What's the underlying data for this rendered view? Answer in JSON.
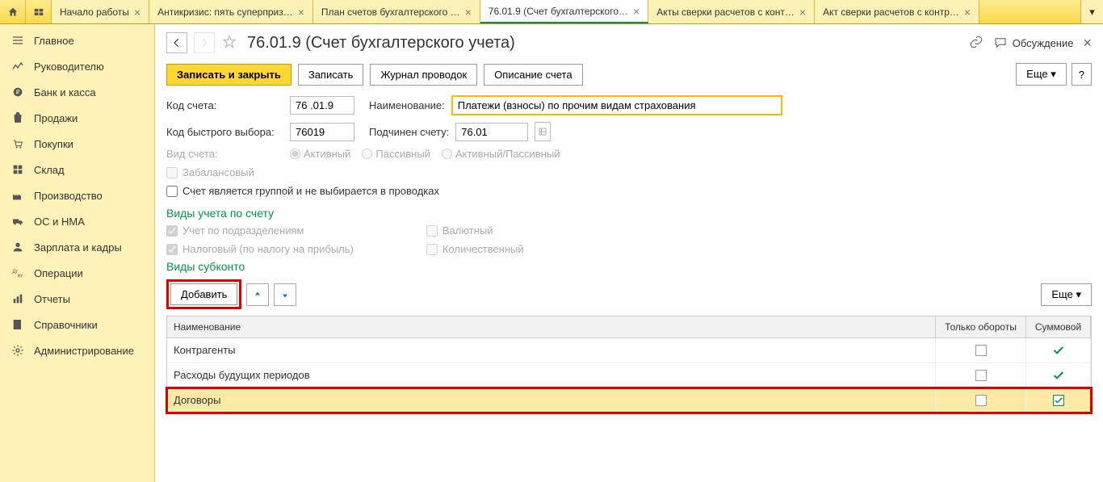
{
  "tabs": [
    {
      "label": "Начало работы",
      "closable": true
    },
    {
      "label": "Антикризис: пять суперприз…",
      "closable": true
    },
    {
      "label": "План счетов бухгалтерского …",
      "closable": true
    },
    {
      "label": "76.01.9 (Счет бухгалтерского…",
      "closable": true,
      "active": true
    },
    {
      "label": "Акты сверки расчетов с конт…",
      "closable": true
    },
    {
      "label": "Акт сверки расчетов с контр…",
      "closable": true
    }
  ],
  "sidebar": [
    {
      "label": "Главное",
      "icon": "menu"
    },
    {
      "label": "Руководителю",
      "icon": "chart"
    },
    {
      "label": "Банк и касса",
      "icon": "coin"
    },
    {
      "label": "Продажи",
      "icon": "bag"
    },
    {
      "label": "Покупки",
      "icon": "cart"
    },
    {
      "label": "Склад",
      "icon": "boxes"
    },
    {
      "label": "Производство",
      "icon": "factory"
    },
    {
      "label": "ОС и НМА",
      "icon": "truck"
    },
    {
      "label": "Зарплата и кадры",
      "icon": "person"
    },
    {
      "label": "Операции",
      "icon": "ops"
    },
    {
      "label": "Отчеты",
      "icon": "bars"
    },
    {
      "label": "Справочники",
      "icon": "book"
    },
    {
      "label": "Администрирование",
      "icon": "gear"
    }
  ],
  "header": {
    "title": "76.01.9 (Счет бухгалтерского учета)",
    "discuss": "Обсуждение"
  },
  "toolbar": {
    "save_close": "Записать и закрыть",
    "save": "Записать",
    "journal": "Журнал проводок",
    "desc": "Описание счета",
    "more": "Еще",
    "help": "?"
  },
  "form": {
    "code_label": "Код счета:",
    "code_value": "76 .01.9",
    "name_label": "Наименование:",
    "name_value": "Платежи (взносы) по прочим видам страхования",
    "quick_label": "Код быстрого выбора:",
    "quick_value": "76019",
    "parent_label": "Подчинен счету:",
    "parent_value": "76.01",
    "type_label": "Вид счета:",
    "type_active": "Активный",
    "type_passive": "Пассивный",
    "type_both": "Активный/Пассивный",
    "offbalance": "Забалансовый",
    "group": "Счет является группой и не выбирается в проводках"
  },
  "sections": {
    "accounting_types": "Виды учета по счету",
    "subconto_types": "Виды субконто"
  },
  "acc_checks": {
    "dept": "Учет по подразделениям",
    "tax": "Налоговый (по налогу на прибыль)",
    "currency": "Валютный",
    "qty": "Количественный"
  },
  "subconto": {
    "add": "Добавить",
    "more": "Еще",
    "col_name": "Наименование",
    "col_turn": "Только обороты",
    "col_sum": "Суммовой",
    "rows": [
      {
        "name": "Контрагенты",
        "turn": false,
        "sum": true
      },
      {
        "name": "Расходы будущих периодов",
        "turn": false,
        "sum": true
      },
      {
        "name": "Договоры",
        "turn": false,
        "sum": true,
        "highlight": true,
        "sum_checkbox": true
      }
    ]
  }
}
